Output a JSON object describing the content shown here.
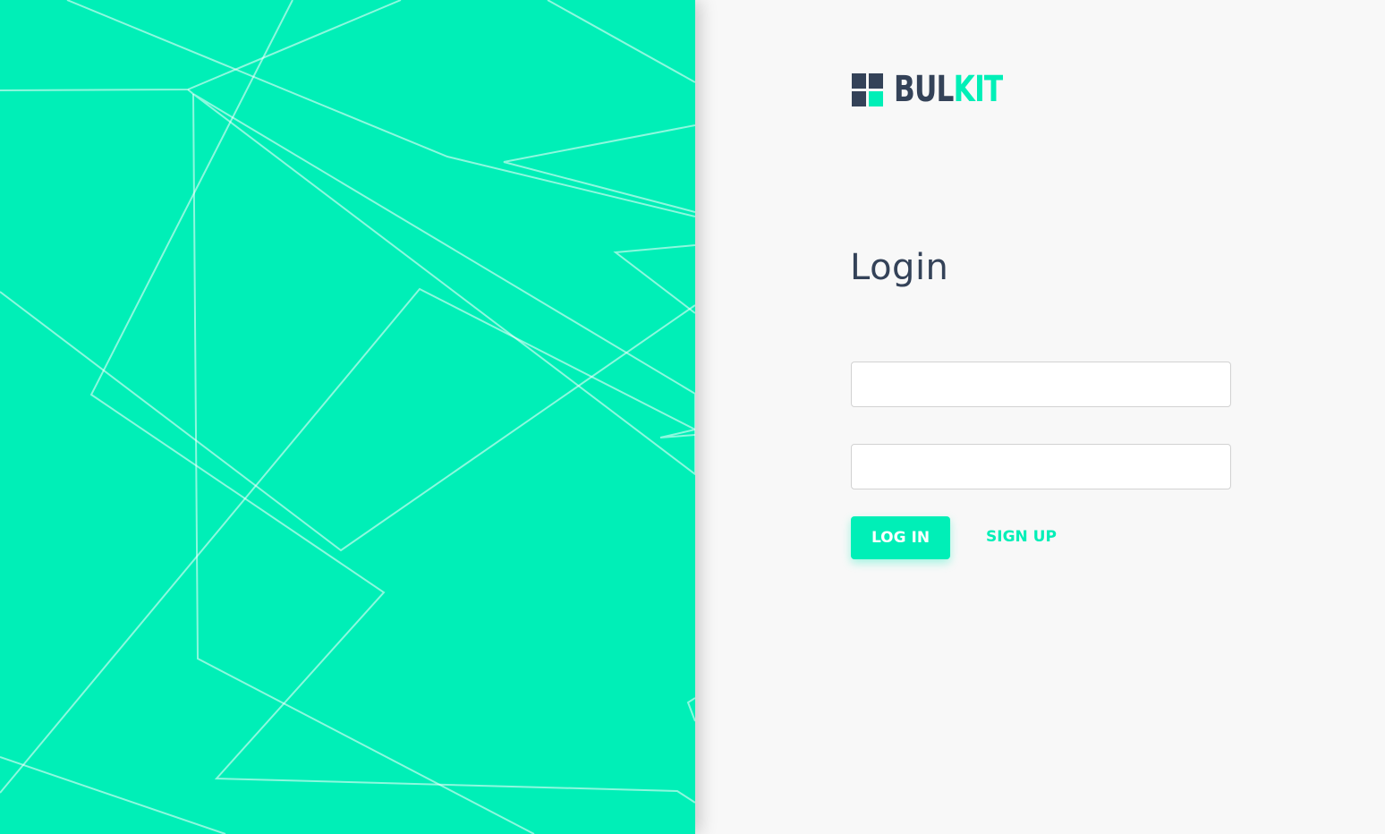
{
  "brand": {
    "name_part_a": "BUL",
    "name_part_b": "KIT",
    "primary_color": "#344258",
    "accent_color": "#00efb7"
  },
  "hero": {
    "background_color": "#00efb7",
    "pattern": "white geometric line polygons"
  },
  "login_form": {
    "title": "Login",
    "username": {
      "value": "",
      "placeholder": ""
    },
    "password": {
      "value": "",
      "placeholder": ""
    },
    "submit_label": "LOG IN",
    "signup_label": "SIGN UP"
  }
}
